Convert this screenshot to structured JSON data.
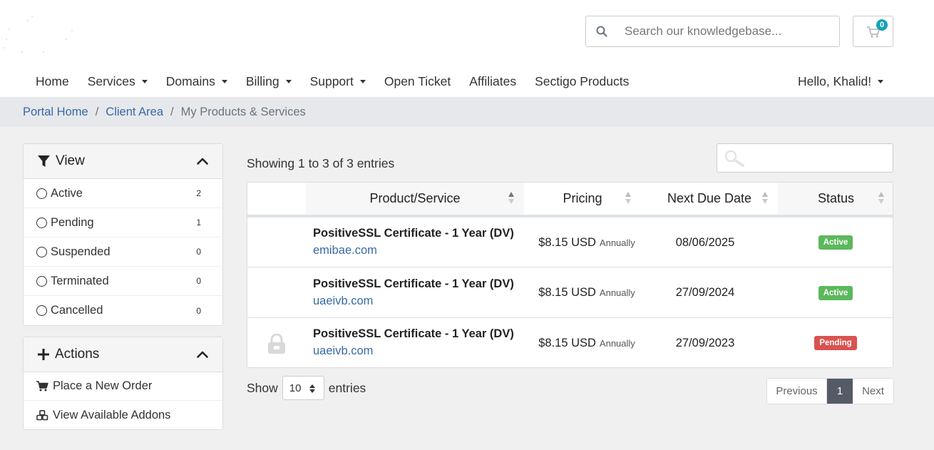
{
  "search": {
    "placeholder": "Search our knowledgebase..."
  },
  "cart": {
    "count": "0"
  },
  "nav": {
    "items": [
      {
        "label": "Home",
        "dropdown": false
      },
      {
        "label": "Services",
        "dropdown": true
      },
      {
        "label": "Domains",
        "dropdown": true
      },
      {
        "label": "Billing",
        "dropdown": true
      },
      {
        "label": "Support",
        "dropdown": true
      },
      {
        "label": "Open Ticket",
        "dropdown": false
      },
      {
        "label": "Affiliates",
        "dropdown": false
      },
      {
        "label": "Sectigo Products",
        "dropdown": false
      }
    ],
    "user_greeting": "Hello, Khalid!"
  },
  "breadcrumb": {
    "home": "Portal Home",
    "client_area": "Client Area",
    "current": "My Products & Services"
  },
  "view_panel": {
    "title": "View",
    "filters": [
      {
        "label": "Active",
        "count": "2"
      },
      {
        "label": "Pending",
        "count": "1"
      },
      {
        "label": "Suspended",
        "count": "0"
      },
      {
        "label": "Terminated",
        "count": "0"
      },
      {
        "label": "Cancelled",
        "count": "0"
      }
    ]
  },
  "actions_panel": {
    "title": "Actions",
    "items": [
      {
        "label": "Place a New Order",
        "icon": "cart-icon"
      },
      {
        "label": "View Available Addons",
        "icon": "cubes-icon"
      }
    ]
  },
  "table": {
    "showing_text": "Showing 1 to 3 of 3 entries",
    "columns": {
      "product": "Product/Service",
      "pricing": "Pricing",
      "due": "Next Due Date",
      "status": "Status"
    },
    "rows": [
      {
        "product": "PositiveSSL Certificate - 1 Year (DV)",
        "domain": "emibae.com",
        "price": "$8.15 USD",
        "cycle": "Annually",
        "due": "08/06/2025",
        "status": "Active",
        "status_color": "#5cb85c",
        "locked": false
      },
      {
        "product": "PositiveSSL Certificate - 1 Year (DV)",
        "domain": "uaeivb.com",
        "price": "$8.15 USD",
        "cycle": "Annually",
        "due": "27/09/2024",
        "status": "Active",
        "status_color": "#5cb85c",
        "locked": false
      },
      {
        "product": "PositiveSSL Certificate - 1 Year (DV)",
        "domain": "uaeivb.com",
        "price": "$8.15 USD",
        "cycle": "Annually",
        "due": "27/09/2023",
        "status": "Pending",
        "status_color": "#d9534f",
        "locked": true
      }
    ],
    "show_label": "Show",
    "page_size": "10",
    "entries_label": "entries"
  },
  "pagination": {
    "previous": "Previous",
    "current_page": "1",
    "next": "Next"
  },
  "colors": {
    "link": "#376aa3",
    "breadcrumb_bg": "#e6e8ec",
    "page_bg": "#f0f0f0",
    "badge_info": "#17a2b8",
    "pager_active": "#555b66"
  }
}
